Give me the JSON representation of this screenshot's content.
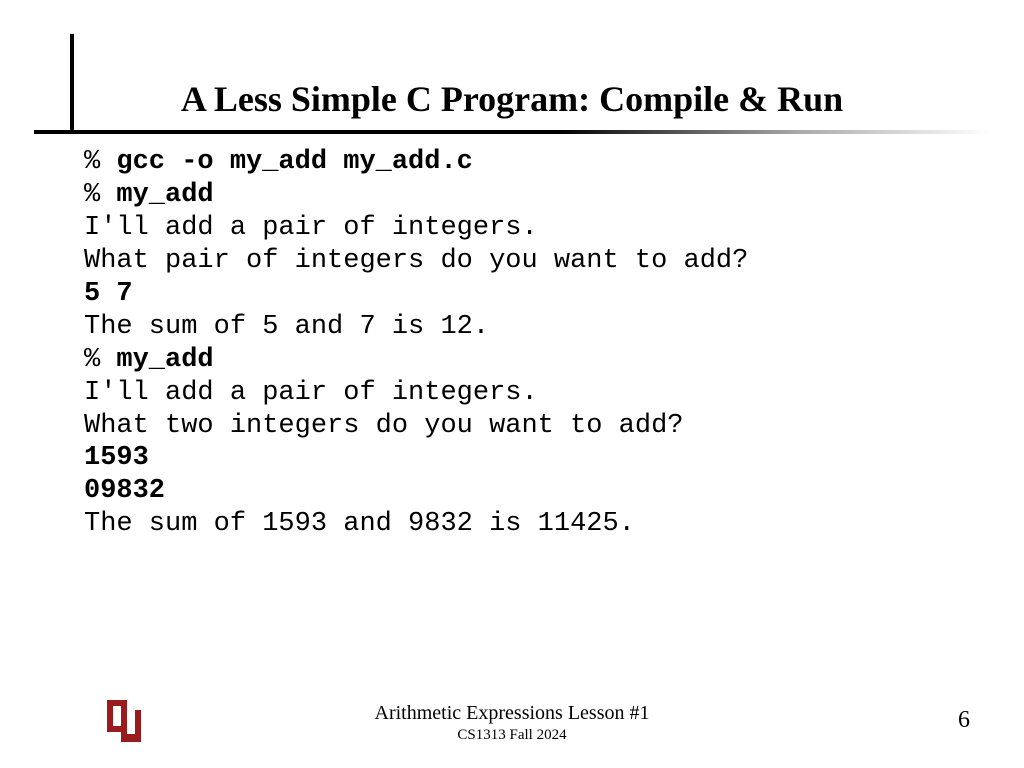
{
  "title": "A Less Simple C Program: Compile & Run",
  "code": {
    "l01a": "% ",
    "l01b": "gcc -o my_add my_add.c",
    "l02a": "% ",
    "l02b": "my_add",
    "l03": "I'll add a pair of integers.",
    "l04": "What pair of integers do you want to add?",
    "l05": "5 7",
    "l06": "The sum of 5 and 7 is 12.",
    "l07a": "% ",
    "l07b": "my_add",
    "l08": "I'll add a pair of integers.",
    "l09": "What two integers do you want to add?",
    "l10": "1593",
    "l11": "09832",
    "l12": "The sum of 1593 and 9832 is 11425."
  },
  "footer": {
    "lesson": "Arithmetic Expressions Lesson #1",
    "course": "CS1313 Fall 2024",
    "page": "6"
  },
  "logo": {
    "letters": "OU",
    "color": "#9a1b1e"
  }
}
